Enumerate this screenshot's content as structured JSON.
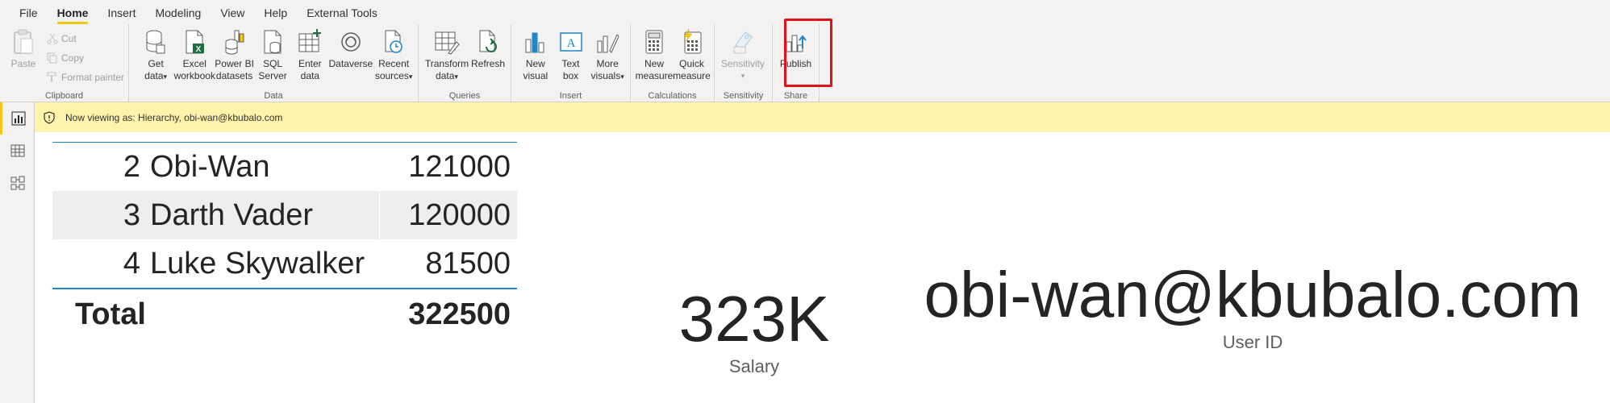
{
  "menu": {
    "tabs": [
      {
        "label": "File",
        "active": false
      },
      {
        "label": "Home",
        "active": true
      },
      {
        "label": "Insert",
        "active": false
      },
      {
        "label": "Modeling",
        "active": false
      },
      {
        "label": "View",
        "active": false
      },
      {
        "label": "Help",
        "active": false
      },
      {
        "label": "External Tools",
        "active": false
      }
    ]
  },
  "ribbon": {
    "clipboard": {
      "label": "Clipboard",
      "paste": "Paste",
      "cut": "Cut",
      "copy": "Copy",
      "format_painter": "Format painter"
    },
    "data": {
      "label": "Data",
      "get_data": [
        "Get",
        "data"
      ],
      "excel": [
        "Excel",
        "workbook"
      ],
      "powerbi": [
        "Power BI",
        "datasets"
      ],
      "sql": [
        "SQL",
        "Server"
      ],
      "enter": [
        "Enter",
        "data"
      ],
      "dataverse": [
        "Dataverse"
      ],
      "recent": [
        "Recent",
        "sources"
      ]
    },
    "queries": {
      "label": "Queries",
      "transform": [
        "Transform",
        "data"
      ],
      "refresh": [
        "Refresh"
      ]
    },
    "insert": {
      "label": "Insert",
      "new_visual": [
        "New",
        "visual"
      ],
      "text_box": [
        "Text",
        "box"
      ],
      "more_visuals": [
        "More",
        "visuals"
      ]
    },
    "calculations": {
      "label": "Calculations",
      "new_measure": [
        "New",
        "measure"
      ],
      "quick_measure": [
        "Quick",
        "measure"
      ]
    },
    "sensitivity": {
      "label": "Sensitivity",
      "button": [
        "Sensitivity"
      ]
    },
    "share": {
      "label": "Share",
      "publish": [
        "Publish"
      ]
    }
  },
  "banner": {
    "text": "Now viewing as: Hierarchy, obi-wan@kbubalo.com"
  },
  "table": {
    "rows": [
      {
        "rank": "2",
        "name": "Obi-Wan",
        "value": "121000"
      },
      {
        "rank": "3",
        "name": "Darth Vader",
        "value": "120000"
      },
      {
        "rank": "4",
        "name": "Luke Skywalker",
        "value": "81500"
      }
    ],
    "total_label": "Total",
    "total_value": "322500"
  },
  "cards": {
    "salary": {
      "value": "323K",
      "label": "Salary"
    },
    "user": {
      "value": "obi-wan@kbubalo.com",
      "label": "User ID"
    }
  },
  "colors": {
    "accent": "#f2c811",
    "table_rule": "#1f86c8",
    "banner_bg": "#fff4ab",
    "highlight": "#e0121a",
    "excel_green": "#1d6f42"
  }
}
